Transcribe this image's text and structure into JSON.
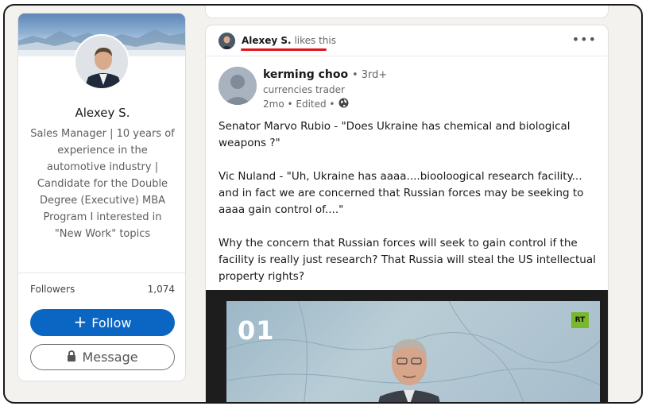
{
  "profile": {
    "name": "Alexey S.",
    "headline": "Sales Manager | 10 years of experience in the automotive industry | Candidate for the Double Degree (Executive) MBA Program I interested in \"New Work\" topics",
    "followers_label": "Followers",
    "followers_count": "1,074",
    "follow_label": "Follow",
    "message_label": "Message"
  },
  "post": {
    "social_name": "Alexey S.",
    "social_action": "likes this",
    "more_icon": "more-icon",
    "author_name": "kerming choo",
    "author_degree": "• 3rd+",
    "author_title": "currencies trader",
    "author_meta": "2mo • Edited •",
    "paragraphs": [
      "Senator Marvo Rubio - \"Does Ukraine has chemical and biological weapons ?\"",
      "Vic Nuland - \"Uh, Ukraine has aaaa....biooloogical research facility... and in fact we are concerned that Russian forces may be seeking to aaaa gain control of....\"",
      "Why the concern that Russian forces will seek to gain control if the facility is really just research? That Russia will steal the US intellectual property rights?"
    ],
    "media": {
      "number": "01",
      "badge": "RT"
    }
  },
  "colors": {
    "accent": "#0a66c2",
    "underline": "#e0141b",
    "badge": "#7ab72c"
  }
}
